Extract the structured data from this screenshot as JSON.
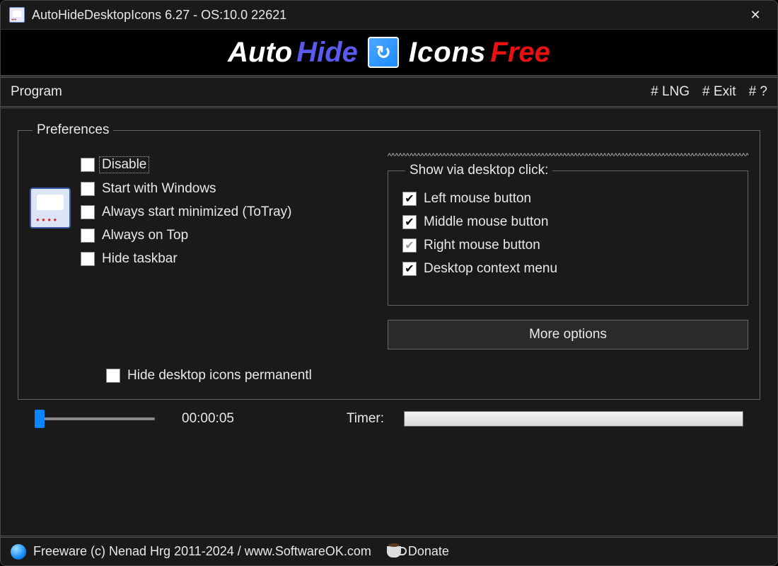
{
  "titlebar": {
    "text": "AutoHideDesktopIcons 6.27 - OS:10.0 22621"
  },
  "banner": {
    "auto": "Auto",
    "hide": "Hide",
    "icons": "Icons",
    "free": "Free"
  },
  "menu": {
    "program": "Program",
    "lng": "# LNG",
    "exit": "# Exit",
    "help": "# ?"
  },
  "prefs": {
    "legend": "Preferences",
    "items": [
      {
        "label": "Disable",
        "checked": false,
        "focused": true
      },
      {
        "label": "Start with Windows",
        "checked": false
      },
      {
        "label": "Always start minimized (ToTray)",
        "checked": false
      },
      {
        "label": "Always on Top",
        "checked": false
      },
      {
        "label": "Hide taskbar",
        "checked": false
      }
    ],
    "show_via": {
      "legend": "Show via desktop click:",
      "items": [
        {
          "label": "Left mouse button",
          "checked": true
        },
        {
          "label": "Middle mouse button",
          "checked": true
        },
        {
          "label": "Right mouse button",
          "checked": true,
          "disabled": true
        },
        {
          "label": "Desktop context menu",
          "checked": true
        }
      ]
    },
    "more_options": "More options",
    "hide_perm": {
      "label": "Hide desktop icons permanentl",
      "checked": false
    }
  },
  "timer": {
    "readout": "00:00:05",
    "label": "Timer:"
  },
  "footer": {
    "text": "Freeware (c) Nenad Hrg 2011-2024 / www.SoftwareOK.com",
    "donate": "Donate"
  }
}
